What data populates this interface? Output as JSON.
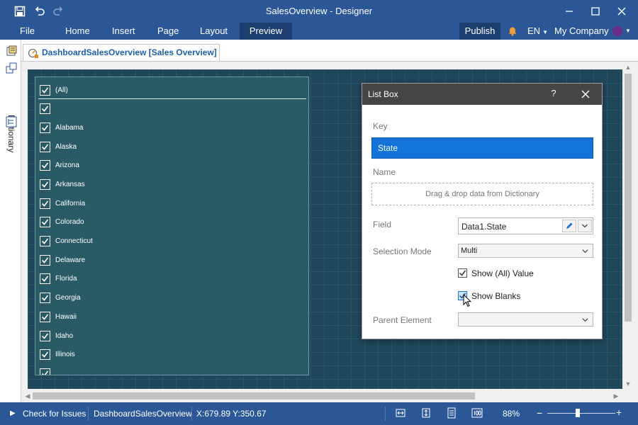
{
  "window": {
    "title": "SalesOverview - Designer",
    "save_icon": "save-icon",
    "undo_icon": "undo-icon",
    "redo_icon": "redo-icon"
  },
  "ribbon": {
    "tabs": [
      {
        "label": "File"
      },
      {
        "label": "Home"
      },
      {
        "label": "Insert"
      },
      {
        "label": "Page"
      },
      {
        "label": "Layout"
      },
      {
        "label": "Preview",
        "active": true
      }
    ],
    "publish_label": "Publish",
    "language": "EN",
    "company": "My Company"
  },
  "sidebar": {
    "dictionary_label": "Dictionary"
  },
  "document_tab": {
    "label": "DashboardSalesOverview [Sales Overview]"
  },
  "listbox": {
    "items": [
      {
        "label": "(All)",
        "checked": true
      },
      {
        "label": "",
        "checked": true
      },
      {
        "label": "Alabama",
        "checked": true
      },
      {
        "label": "Alaska",
        "checked": true
      },
      {
        "label": "Arizona",
        "checked": true
      },
      {
        "label": "Arkansas",
        "checked": true
      },
      {
        "label": "California",
        "checked": true
      },
      {
        "label": "Colorado",
        "checked": true
      },
      {
        "label": "Connecticut",
        "checked": true
      },
      {
        "label": "Delaware",
        "checked": true
      },
      {
        "label": "Florida",
        "checked": true
      },
      {
        "label": "Georgia",
        "checked": true
      },
      {
        "label": "Hawaii",
        "checked": true
      },
      {
        "label": "Idaho",
        "checked": true
      },
      {
        "label": "Illinois",
        "checked": true
      }
    ]
  },
  "dialog": {
    "title": "List Box",
    "help": "?",
    "key_label": "Key",
    "key_value": "State",
    "name_label": "Name",
    "name_placeholder": "Drag & drop data from Dictionary",
    "field_label": "Field",
    "field_value": "Data1.State",
    "selection_mode_label": "Selection Mode",
    "selection_mode_value": "Multi",
    "show_all_label": "Show (All) Value",
    "show_all_checked": true,
    "show_blanks_label": "Show Blanks",
    "show_blanks_checked": true,
    "parent_element_label": "Parent Element",
    "parent_element_value": ""
  },
  "statusbar": {
    "check_issues": "Check for Issues",
    "dashboard_name": "DashboardSalesOverview",
    "coordinates": "X:679.89 Y:350.67",
    "zoom": "88%",
    "zoom_level_fraction": 0.45
  },
  "colors": {
    "chrome": "#2b5797",
    "canvas": "#1f4659",
    "listbox": "#2b5a67",
    "accent": "#1473d9"
  }
}
